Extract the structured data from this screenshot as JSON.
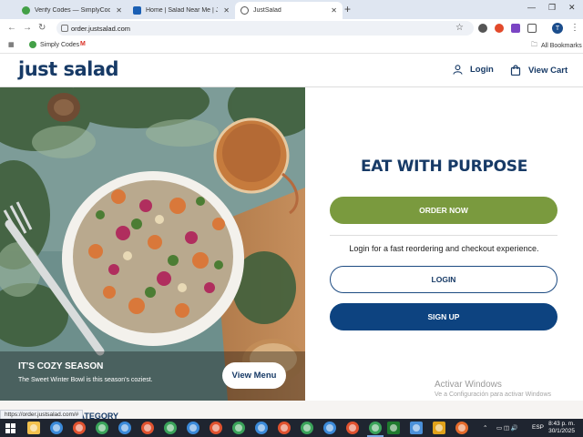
{
  "browser": {
    "tabs": [
      {
        "label": "Verify Codes — SimplyCodes",
        "fav_color": "#43a047"
      },
      {
        "label": "Home | Salad Near Me | Just Sa",
        "fav_color": "#1a5fb4"
      },
      {
        "label": "JustSalad",
        "fav_color": "#555555"
      }
    ],
    "url": "order.justsalad.com",
    "bookmarks": [
      {
        "label": "Simply Codes"
      }
    ],
    "all_bookmarks_label": "All Bookmarks",
    "profile_initial": "T"
  },
  "site": {
    "logo": "just salad",
    "login_label": "Login",
    "cart_label": "View Cart",
    "headline": "EAT WITH PURPOSE",
    "order_now_label": "ORDER NOW",
    "login_prompt": "Login for a fast reordering and checkout experience.",
    "login_button_label": "LOGIN",
    "signup_button_label": "SIGN UP",
    "hero": {
      "title": "IT'S COZY SEASON",
      "subtitle": "The Sweet Winter Bowl is this season's coziest.",
      "view_menu_label": "View Menu"
    },
    "category_label": "CATEGORY"
  },
  "status_bar_url": "https://order.justsalad.com/#",
  "watermark": {
    "line1": "Activar Windows",
    "line2": "Ve a Configuración para activar Windows"
  },
  "taskbar": {
    "language": "ESP",
    "time": "8:43 p. m.",
    "date": "30/1/2025"
  },
  "colors": {
    "brand_navy": "#173a66",
    "order_green": "#7a9a3e",
    "signup_blue": "#0d4380"
  }
}
